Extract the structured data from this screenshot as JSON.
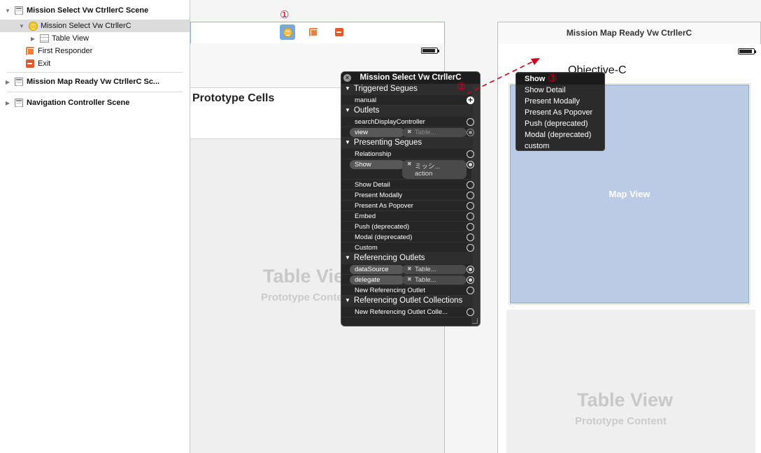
{
  "outline": {
    "scene1_label": "Mission Select Vw CtrllerC Scene",
    "vc_label": "Mission Select Vw CtrllerC",
    "tableview_label": "Table View",
    "first_responder_label": "First Responder",
    "exit_label": "Exit",
    "scene2_label": "Mission Map Ready Vw CtrllerC Sc...",
    "scene3_label": "Navigation Controller Scene"
  },
  "canvas": {
    "step1": "①",
    "step2": "②",
    "step3": "③",
    "prototype_cells": "Prototype Cells",
    "table_view_placeholder": "Table View",
    "prototype_content_placeholder": "Prototype Content",
    "scene2_title": "Mission Map Ready Vw CtrllerC",
    "objc_label": "Objective-C",
    "map_view_label": "Map View"
  },
  "hud": {
    "title": "Mission Select Vw CtrllerC",
    "close_glyph": "×",
    "sections": {
      "triggered_segues": "Triggered Segues",
      "outlets": "Outlets",
      "presenting_segues": "Presenting Segues",
      "referencing_outlets": "Referencing Outlets",
      "referencing_outlet_collections": "Referencing Outlet Collections"
    },
    "manual": "manual",
    "search_display_controller": "searchDisplayController",
    "view": "view",
    "view_target": "Table...",
    "relationship": "Relationship",
    "show": "Show",
    "show_target": "ミッシ...",
    "show_target_sub": "action",
    "show_detail": "Show Detail",
    "present_modally": "Present Modally",
    "present_as_popover": "Present As Popover",
    "embed": "Embed",
    "push": "Push (deprecated)",
    "modal": "Modal (deprecated)",
    "custom": "Custom",
    "data_source": "dataSource",
    "data_source_target": "Table...",
    "delegate": "delegate",
    "delegate_target": "Table...",
    "new_referencing_outlet": "New Referencing Outlet",
    "new_referencing_outlet_collection": "New Referencing Outlet Colle..."
  },
  "segue_menu": {
    "items": [
      "Show",
      "Show Detail",
      "Present Modally",
      "Present As Popover",
      "Push (deprecated)",
      "Modal (deprecated)",
      "custom"
    ]
  },
  "colors": {
    "annotation_red": "#d0021b",
    "map_view_fill": "#bbcbe6",
    "selection_blue": "#7aa7dc"
  }
}
